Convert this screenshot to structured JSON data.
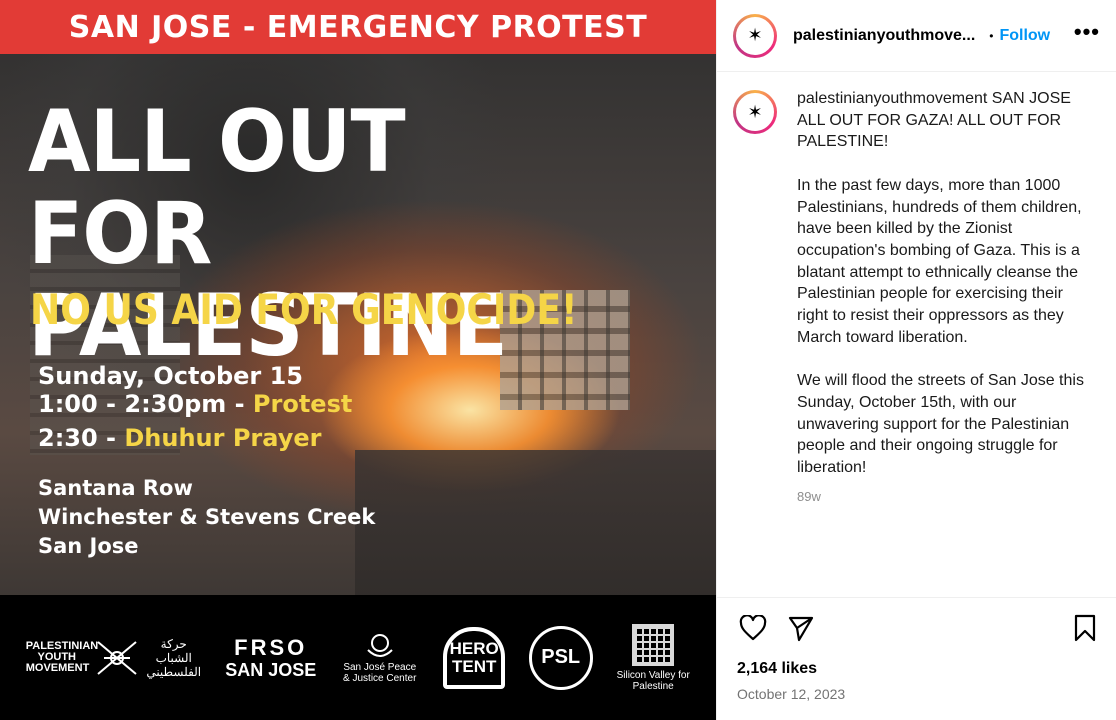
{
  "poster": {
    "banner": "SAN JOSE - EMERGENCY PROTEST",
    "headline_line1": "ALL OUT FOR",
    "headline_line2": "PALESTINE",
    "subhead": "NO US AID FOR GENOCIDE!",
    "date_line": "Sunday, October 15",
    "time_range": "1:00 - 2:30pm - ",
    "time_event": "Protest",
    "prayer_time": "2:30 - ",
    "prayer_event": "Dhuhur Prayer",
    "address_1": "Santana Row",
    "address_2": "Winchester & Stevens Creek",
    "address_3": "San Jose",
    "logos": {
      "pym_text": "PALESTINIAN YOUTH MOVEMENT",
      "pym_arabic": "حركة الشباب الفلسطيني",
      "frso_1": "FRSO",
      "frso_2": "SAN JOSE",
      "sjp_text": "San José Peace & Justice Center",
      "hero_1": "HERO",
      "hero_2": "TENT",
      "psl": "PSL",
      "svp_text": "Silicon Valley for Palestine"
    }
  },
  "post": {
    "username_header": "palestinianyouthmove...",
    "dot": "•",
    "follow_label": "Follow",
    "more_label": "•••",
    "caption_user": "palestinianyouthmovement",
    "caption_body": " SAN JOSE ALL OUT FOR GAZA! ALL OUT FOR PALESTINE!\n\nIn the past few days, more than 1000 Palestinians, hundreds of them children, have been killed by the Zionist occupation's bombing of Gaza. This is a blatant attempt to ethnically cleanse the Palestinian people for exercising their right to resist their oppressors as they March toward liberation.\n\nWe will flood the streets of San Jose this Sunday, October 15th, with our unwavering support for the Palestinian people and their ongoing struggle for liberation!",
    "time_ago": "89w",
    "likes": "2,164 likes",
    "date": "October 12, 2023",
    "icons": {
      "like": "heart-icon",
      "share": "send-icon",
      "save": "bookmark-icon",
      "more": "more-options-icon"
    }
  }
}
